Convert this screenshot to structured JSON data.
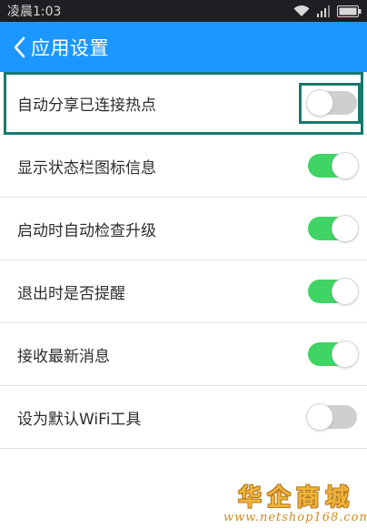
{
  "status_bar": {
    "time": "凌晨1:03",
    "icons": [
      "wifi-icon",
      "signal-icon",
      "battery-icon"
    ]
  },
  "header": {
    "back_icon": "chevron-left-icon",
    "title": "应用设置",
    "background": "#1c97ff"
  },
  "settings": [
    {
      "label": "自动分享已连接热点",
      "enabled": false
    },
    {
      "label": "显示状态栏图标信息",
      "enabled": true
    },
    {
      "label": "启动时自动检查升级",
      "enabled": true
    },
    {
      "label": "退出时是否提醒",
      "enabled": true
    },
    {
      "label": "接收最新消息",
      "enabled": true
    },
    {
      "label": "设为默认WiFi工具",
      "enabled": false
    }
  ],
  "colors": {
    "toggle_on": "#3fd463",
    "toggle_off": "#cfcfcf",
    "highlight": "#16786e"
  },
  "watermark": {
    "title": "华企商城",
    "url": "www.netshop168.com"
  }
}
